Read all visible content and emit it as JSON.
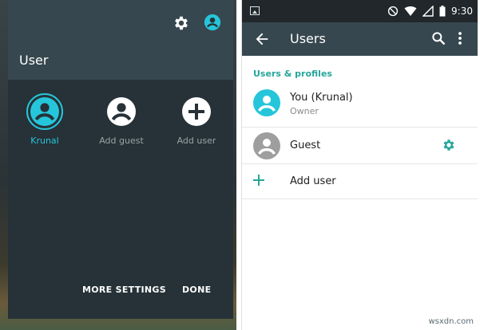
{
  "quick_settings": {
    "title": "User",
    "header_icons": [
      "gear-icon",
      "account-circle-icon"
    ],
    "users": [
      {
        "name": "Krunal",
        "icon": "account-circle-icon",
        "active": true
      },
      {
        "name": "Add guest",
        "icon": "account-circle-icon",
        "active": false
      },
      {
        "name": "Add user",
        "icon": "plus-circle-icon",
        "active": false
      }
    ],
    "actions": {
      "more_settings": "MORE SETTINGS",
      "done": "DONE"
    }
  },
  "status_bar": {
    "time": "9:30"
  },
  "users_screen": {
    "title": "Users",
    "section_title": "Users & profiles",
    "you": {
      "name": "You (Krunal)",
      "role": "Owner"
    },
    "guest": {
      "name": "Guest"
    },
    "add_user": {
      "label": "Add user"
    }
  },
  "colors": {
    "accent": "#26c6da",
    "teal": "#26a69a",
    "appbar": "#37474f",
    "panel": "#263238"
  },
  "watermark": "wsxdn.com"
}
